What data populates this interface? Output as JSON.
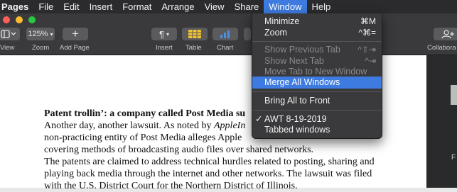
{
  "menubar": {
    "app": "Pages",
    "items": [
      "File",
      "Edit",
      "Insert",
      "Format",
      "Arrange",
      "View",
      "Share",
      "Window",
      "Help"
    ]
  },
  "toolbar": {
    "view_label": "View",
    "zoom_value": "125%",
    "zoom_label": "Zoom",
    "add_page_label": "Add Page",
    "insert_label": "Insert",
    "table_label": "Table",
    "chart_label": "Chart",
    "collaborate_label": "Collabora"
  },
  "window_menu": {
    "minimize": "Minimize",
    "minimize_sc": "⌘M",
    "zoom": "Zoom",
    "zoom_sc": "^⌘=",
    "show_prev_tab": "Show Previous Tab",
    "show_prev_tab_sc": "^⇧⇥",
    "show_next_tab": "Show Next Tab",
    "show_next_tab_sc": "^⇥",
    "move_tab": "Move Tab to New Window",
    "merge_all": "Merge All Windows",
    "bring_all": "Bring All to Front",
    "check_mark": "✓",
    "doc1": "AWT 8-19-2019",
    "doc2": "Tabbed windows"
  },
  "document": {
    "title_bold": "Patent trollin’: a company called Post Media su",
    "l1_a": "Another day, another lawsuit. As noted by ",
    "l1_b": "AppleIn",
    "l2": "non-practicing entity of Post Media alleges Apple",
    "l3": "covering methods of broadcasting audio files over shared networks.",
    "l4": "The patents are claimed to address technical hurdles related to posting, sharing and",
    "l5": "playing back media through the internet and other networks. The lawsuit was filed",
    "l6": "with the U.S. District Court for the Northern District of Illinois."
  },
  "right_panel": {
    "label": "F"
  }
}
